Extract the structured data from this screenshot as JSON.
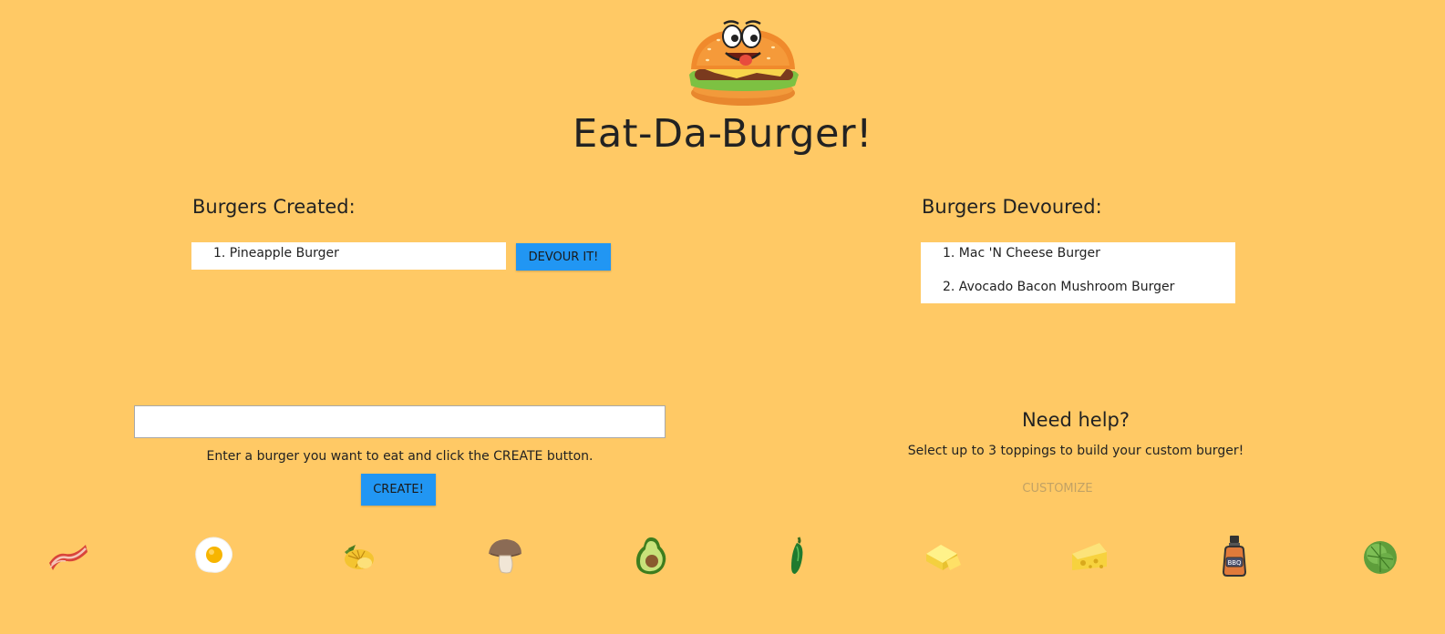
{
  "header": {
    "title": "Eat-Da-Burger!",
    "logo_icon": "smiling-burger-logo"
  },
  "created": {
    "heading": "Burgers Created:",
    "items": [
      "1. Pineapple Burger"
    ],
    "devour_label": "DEVOUR IT!"
  },
  "devoured": {
    "heading": "Burgers Devoured:",
    "items": [
      "1. Mac 'N Cheese Burger",
      "2. Avocado Bacon Mushroom Burger"
    ]
  },
  "create_form": {
    "input_value": "",
    "hint": "Enter a burger you want to eat and click the CREATE button.",
    "create_label": "CREATE!"
  },
  "help": {
    "title": "Need help?",
    "subtitle": "Select up to 3 toppings to build your custom burger!",
    "customize_label": "CUSTOMIZE"
  },
  "toppings": [
    "bacon-icon",
    "fried-egg-icon",
    "pineapple-icon",
    "mushroom-icon",
    "avocado-icon",
    "jalapeno-icon",
    "butter-icon",
    "cheese-icon",
    "bbq-sauce-icon",
    "lettuce-icon"
  ],
  "colors": {
    "background": "#FFC965",
    "button": "#2196F3",
    "customize_text": "#C2A265"
  }
}
